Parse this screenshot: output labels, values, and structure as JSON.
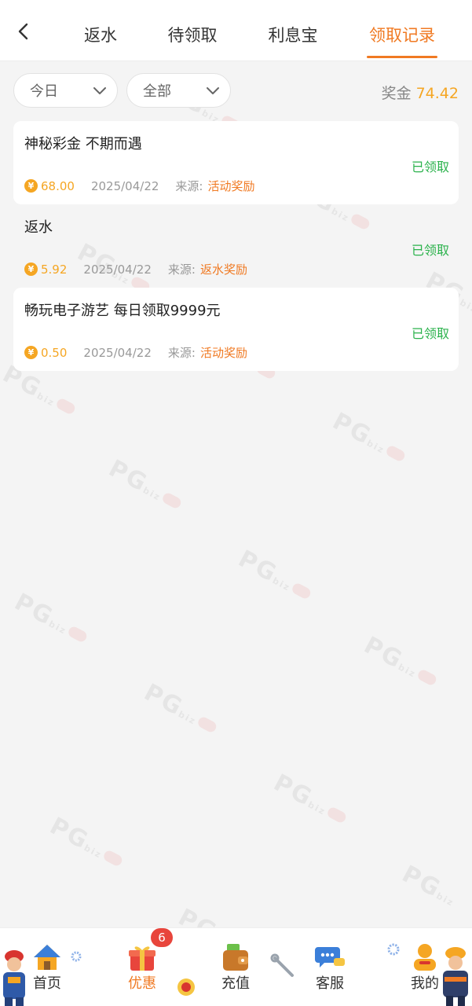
{
  "header": {
    "tabs": [
      {
        "label": "返水",
        "active": false
      },
      {
        "label": "待领取",
        "active": false
      },
      {
        "label": "利息宝",
        "active": false
      },
      {
        "label": "领取记录",
        "active": true
      }
    ]
  },
  "filters": {
    "date_label": "今日",
    "type_label": "全部"
  },
  "bonus": {
    "label": "奖金",
    "value": "74.42"
  },
  "records": [
    {
      "title": "神秘彩金 不期而遇",
      "status": "已领取",
      "amount": "68.00",
      "date": "2025/04/22",
      "source_label": "来源:",
      "source": "活动奖励"
    },
    {
      "title": "返水",
      "status": "已领取",
      "amount": "5.92",
      "date": "2025/04/22",
      "source_label": "来源:",
      "source": "返水奖励"
    },
    {
      "title": "畅玩电子游艺 每日领取9999元",
      "status": "已领取",
      "amount": "0.50",
      "date": "2025/04/22",
      "source_label": "来源:",
      "source": "活动奖励"
    }
  ],
  "coin_symbol": "¥",
  "nav": {
    "items": [
      {
        "label": "首页",
        "icon": "house-icon",
        "active": false
      },
      {
        "label": "优惠",
        "icon": "gift-icon",
        "active": true
      },
      {
        "label": "充值",
        "icon": "wallet-icon",
        "active": false
      },
      {
        "label": "客服",
        "icon": "chat-icon",
        "active": false
      },
      {
        "label": "我的",
        "icon": "profile-icon",
        "active": false
      }
    ],
    "promo_badge": "6"
  },
  "watermark": {
    "text": "PG",
    "suffix": "biz"
  },
  "colors": {
    "accent": "#f07a23",
    "coin": "#f5a623",
    "success": "#2bb24c",
    "badge": "#e8453c"
  }
}
